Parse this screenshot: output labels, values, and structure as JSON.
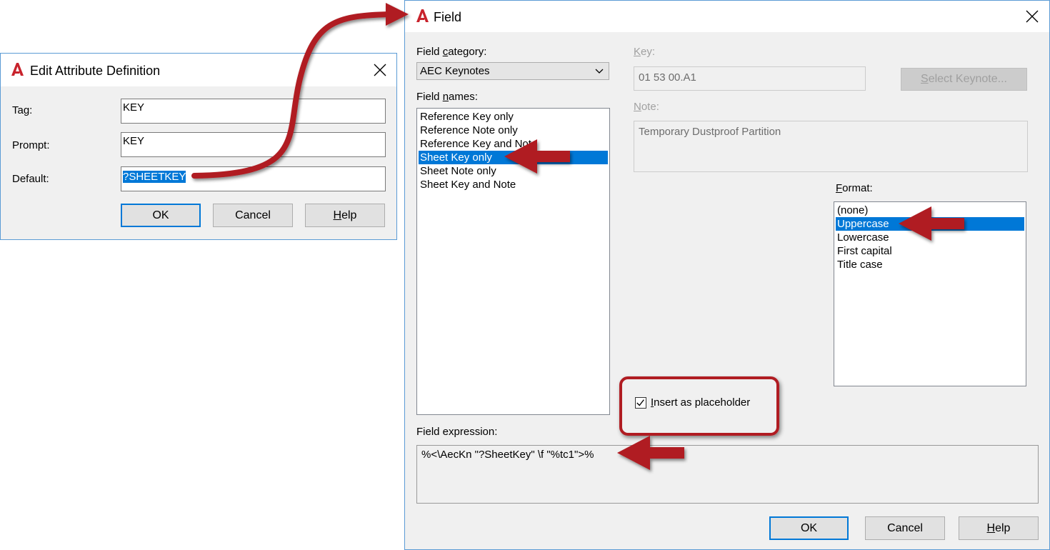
{
  "edit_dialog": {
    "title": "Edit Attribute Definition",
    "tag_label": "Tag:",
    "tag_value": "KEY",
    "prompt_label": "Prompt:",
    "prompt_value": "KEY",
    "default_label": "Default:",
    "default_value": "?SHEETKEY",
    "ok_label": "OK",
    "cancel_label": "Cancel",
    "help_label": "Help",
    "help_mnemonic": "H",
    "help_rest": "elp"
  },
  "field_dialog": {
    "title": "Field",
    "category_label_pre": "Field ",
    "category_label_mn": "c",
    "category_label_post": "ategory:",
    "category_value": "AEC Keynotes",
    "names_label_pre": "Field ",
    "names_label_mn": "n",
    "names_label_post": "ames:",
    "field_names": [
      "Reference Key only",
      "Reference Note only",
      "Reference Key and Note",
      "Sheet Key only",
      "Sheet Note only",
      "Sheet Key and Note"
    ],
    "selected_field_name": "Sheet Key only",
    "key_label_mn": "K",
    "key_label_rest": "ey:",
    "key_value": "01 53 00.A1",
    "select_keynote_mn": "S",
    "select_keynote_rest": "elect Keynote...",
    "note_label_mn": "N",
    "note_label_rest": "ote:",
    "note_value": "Temporary Dustproof Partition",
    "format_label_mn": "F",
    "format_label_rest": "ormat:",
    "formats": [
      "(none)",
      "Uppercase",
      "Lowercase",
      "First capital",
      "Title case"
    ],
    "selected_format": "Uppercase",
    "placeholder_mn": "I",
    "placeholder_rest": "nsert as placeholder",
    "placeholder_checked": true,
    "expression_label": "Field expression:",
    "expression_value": "%<\\AecKn \"?SheetKey\" \\f \"%tc1\">%",
    "ok_label": "OK",
    "cancel_label": "Cancel",
    "help_mnemonic": "H",
    "help_rest": "elp"
  },
  "colors": {
    "selection": "#0078d7",
    "annotation_red": "#b01c22",
    "dialog_border": "#5b9bd5"
  }
}
